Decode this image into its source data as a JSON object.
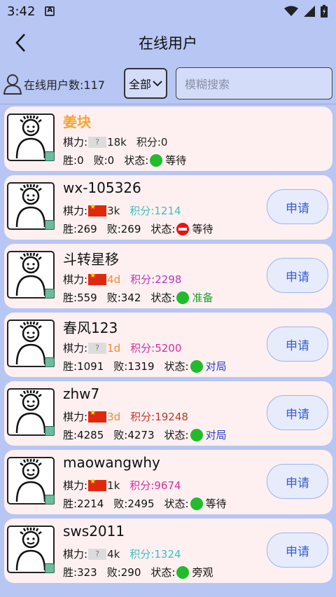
{
  "status_bar": {
    "time": "3:42"
  },
  "header": {
    "title": "在线用户"
  },
  "toolbar": {
    "count_label": "在线用户数:117",
    "filter_value": "全部",
    "search_placeholder": "模糊搜索"
  },
  "labels": {
    "rating": "棋力:",
    "score_prefix": "积分:",
    "win": "胜:",
    "loss": "败:",
    "status": "状态:",
    "apply": "申请"
  },
  "colors": {
    "background": "#b7c6f3",
    "card": "#fef0f1",
    "self_name": "#f7a32a",
    "apply_text": "#3a5fc8",
    "online_dot": "#22bb2c",
    "busy_dot": "#ee1111"
  },
  "users": [
    {
      "name": "姜块",
      "self": true,
      "flag": "unknown",
      "rating": "18k",
      "rating_color": "#222222",
      "score": "积分:0",
      "score_color": "#222222",
      "wins": "0",
      "losses": "0",
      "status_icon": "online-dot",
      "status": "等待",
      "status_color": "#111111"
    },
    {
      "name": "wx-105326",
      "self": false,
      "flag": "cn",
      "rating": "3k",
      "rating_color": "#222222",
      "score": "积分:1214",
      "score_color": "#3fbfbf",
      "wins": "269",
      "losses": "269",
      "status_icon": "busy-dot",
      "status": "等待",
      "status_color": "#111111"
    },
    {
      "name": "斗转星移",
      "self": false,
      "flag": "cn",
      "rating": "4d",
      "rating_color": "#f08a2c",
      "score": "积分:2298",
      "score_color": "#b23ab8",
      "wins": "559",
      "losses": "342",
      "status_icon": "online-dot",
      "status": "准备",
      "status_color": "#1e9e2e"
    },
    {
      "name": "春风123",
      "self": false,
      "flag": "unknown",
      "rating": "1d",
      "rating_color": "#f08a2c",
      "score": "积分:5200",
      "score_color": "#d42fa0",
      "wins": "1091",
      "losses": "1319",
      "status_icon": "online-dot",
      "status": "对局",
      "status_color": "#2a3fc8"
    },
    {
      "name": "zhw7",
      "self": false,
      "flag": "cn",
      "rating": "3d",
      "rating_color": "#f08a2c",
      "score": "积分:19248",
      "score_color": "#c0392b",
      "wins": "4285",
      "losses": "4273",
      "status_icon": "online-dot",
      "status": "对局",
      "status_color": "#2a3fc8"
    },
    {
      "name": "maowangwhy",
      "self": false,
      "flag": "cn",
      "rating": "1k",
      "rating_color": "#222222",
      "score": "积分:9674",
      "score_color": "#d42fa0",
      "wins": "2214",
      "losses": "2495",
      "status_icon": "online-dot",
      "status": "等待",
      "status_color": "#111111"
    },
    {
      "name": "sws2011",
      "self": false,
      "flag": "unknown",
      "rating": "4k",
      "rating_color": "#222222",
      "score": "积分:1324",
      "score_color": "#3fbfbf",
      "wins": "323",
      "losses": "290",
      "status_icon": "online-dot",
      "status": "旁观",
      "status_color": "#111111"
    }
  ]
}
